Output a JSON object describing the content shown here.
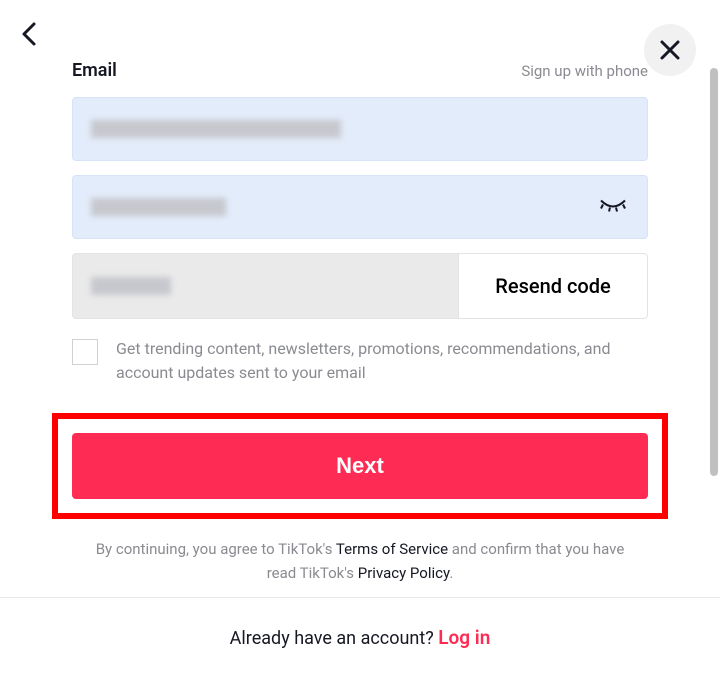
{
  "header": {
    "label": "Email",
    "alt_link": "Sign up with phone"
  },
  "inputs": {
    "email_value": "",
    "password_value": "",
    "code_value": ""
  },
  "resend_label": "Resend code",
  "checkbox_label": "Get trending content, newsletters, promotions, recommendations, and account updates sent to your email",
  "next_label": "Next",
  "terms": {
    "prefix": "By continuing, you agree to TikTok's ",
    "tos": "Terms of Service",
    "mid": " and confirm that you have read TikTok's ",
    "privacy": "Privacy Policy",
    "suffix": "."
  },
  "footer": {
    "text": "Already have an account? ",
    "login": "Log in"
  }
}
